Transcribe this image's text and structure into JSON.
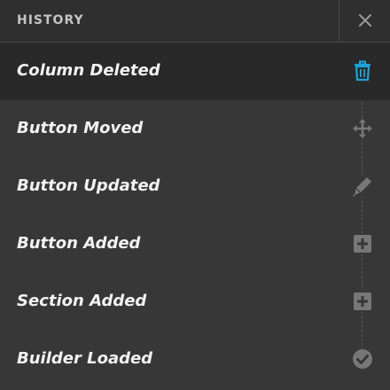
{
  "header": {
    "title": "HISTORY"
  },
  "items": [
    {
      "label": "Column Deleted",
      "icon": "trash-icon",
      "active": true
    },
    {
      "label": "Button Moved",
      "icon": "move-icon",
      "active": false
    },
    {
      "label": "Button Updated",
      "icon": "pen-icon",
      "active": false
    },
    {
      "label": "Button Added",
      "icon": "plus-square-icon",
      "active": false
    },
    {
      "label": "Section Added",
      "icon": "plus-square-icon",
      "active": false
    },
    {
      "label": "Builder Loaded",
      "icon": "check-circle-icon",
      "active": false
    }
  ],
  "colors": {
    "active_icon": "#1fa2d6",
    "inactive_icon": "#777777"
  }
}
